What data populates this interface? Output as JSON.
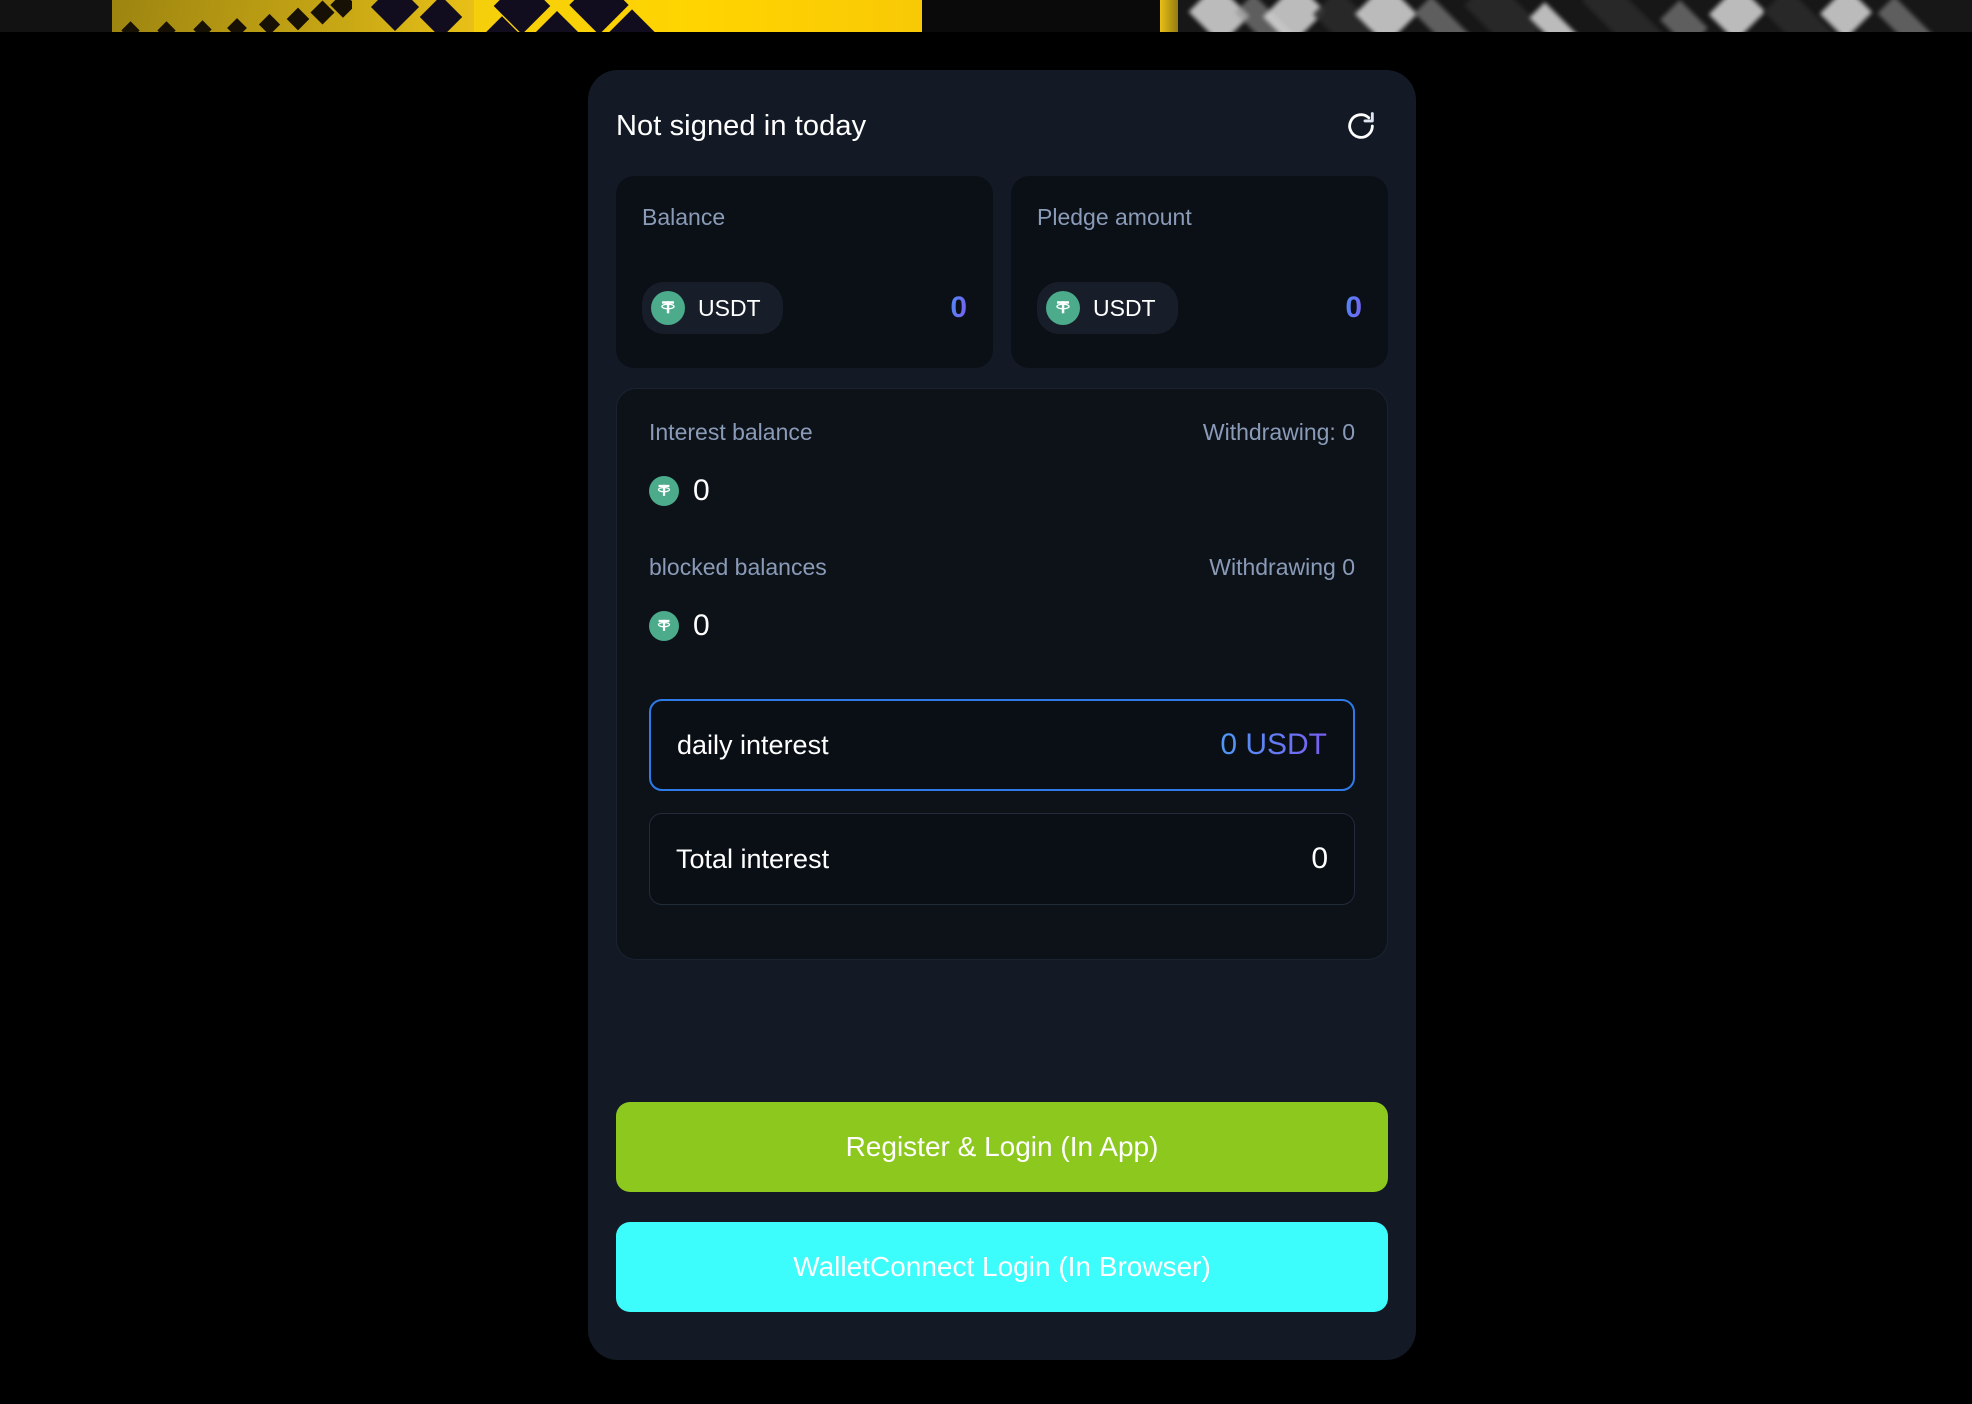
{
  "banner": {
    "name": "promo-banner-strip",
    "description": "partially cut-off promotional banner at very top of page"
  },
  "header": {
    "title": "Not signed in today",
    "refresh_icon": "refresh-icon"
  },
  "balance_cards": [
    {
      "label": "Balance",
      "token_icon": "tether-usdt-icon",
      "token": "USDT",
      "value": "0"
    },
    {
      "label": "Pledge amount",
      "token_icon": "tether-usdt-icon",
      "token": "USDT",
      "value": "0"
    }
  ],
  "interest_panel": {
    "interest_balance": {
      "label": "Interest balance",
      "withdrawing": "Withdrawing: 0",
      "token_icon": "tether-usdt-icon",
      "value": "0"
    },
    "blocked_balances": {
      "label": "blocked balances",
      "withdrawing": "Withdrawing 0",
      "token_icon": "tether-usdt-icon",
      "value": "0"
    },
    "daily_interest": {
      "label": "daily interest",
      "value": "0 USDT"
    },
    "total_interest": {
      "label": "Total interest",
      "value": "0"
    }
  },
  "actions": {
    "register_login": "Register & Login (In App)",
    "walletconnect_login": "WalletConnect Login (In Browser)"
  },
  "colors": {
    "page_background": "#000000",
    "card_background": "#131a26",
    "panel_background": "#0d1219",
    "muted_label": "#8a9bb8",
    "accent_blue": "#2e7be8",
    "gradient_start": "#4d8df5",
    "gradient_end": "#7a5cf0",
    "tether_green": "#4bab8a",
    "register_button": "#8cc81e",
    "walletconnect_button": "#3dfcfc",
    "banner_yellow": "#ffd400"
  }
}
